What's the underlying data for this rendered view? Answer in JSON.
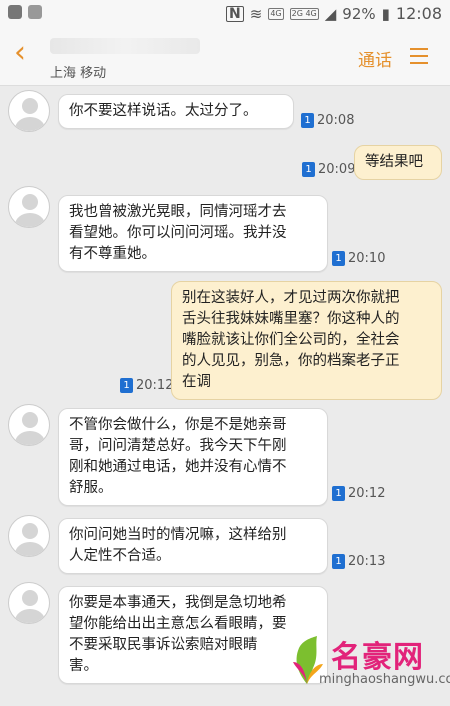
{
  "statusbar": {
    "n_icon": "N",
    "lte_badge": "4G",
    "lte2_badge": "2G 4G",
    "battery": "92%",
    "time": "12:08"
  },
  "header": {
    "back_icon": "chevron-left-icon",
    "subtitle": "上海 移动",
    "call_label": "通话",
    "menu_icon": "hamburger-menu-icon",
    "accent_color": "#e5902c"
  },
  "messages": [
    {
      "dir": "in",
      "text": "你不要这样说话。太过分了。",
      "sim": "1",
      "time": "20:08"
    },
    {
      "dir": "out",
      "text": "等结果吧",
      "sim": "1",
      "time": "20:09"
    },
    {
      "dir": "in",
      "lines": [
        "我也曾被激光晃眼，同情河瑶才去",
        "看望她。你可以问问河瑶。我并没",
        "有不尊重她。"
      ],
      "sim": "1",
      "time": "20:10"
    },
    {
      "dir": "out",
      "lines": [
        "别在这装好人，才见过两次你就把",
        "舌头往我妹妹嘴里塞？你这种人的",
        "嘴脸就该让你们全公司的，全社会",
        "的人见见，别急，你的档案老子正",
        "在调"
      ],
      "sim": "1",
      "time": "20:12"
    },
    {
      "dir": "in",
      "lines": [
        "不管你会做什么，你是不是她亲哥",
        "哥，问问清楚总好。我今天下午刚",
        "刚和她通过电话，她并没有心情不",
        "舒服。"
      ],
      "sim": "1",
      "time": "20:12"
    },
    {
      "dir": "in",
      "lines": [
        "你问问她当时的情况嘛，这样给别",
        "人定性不合适。"
      ],
      "sim": "1",
      "time": "20:13"
    },
    {
      "dir": "in",
      "lines": [
        "你要是本事通天，我倒是急切地希",
        "望你能给出出主意怎么看眼睛，要",
        "不要采取民事诉讼索赔对眼睛",
        "害。"
      ]
    }
  ],
  "watermark": {
    "name": "名豪网",
    "url": "minghaoshangwu.com"
  }
}
